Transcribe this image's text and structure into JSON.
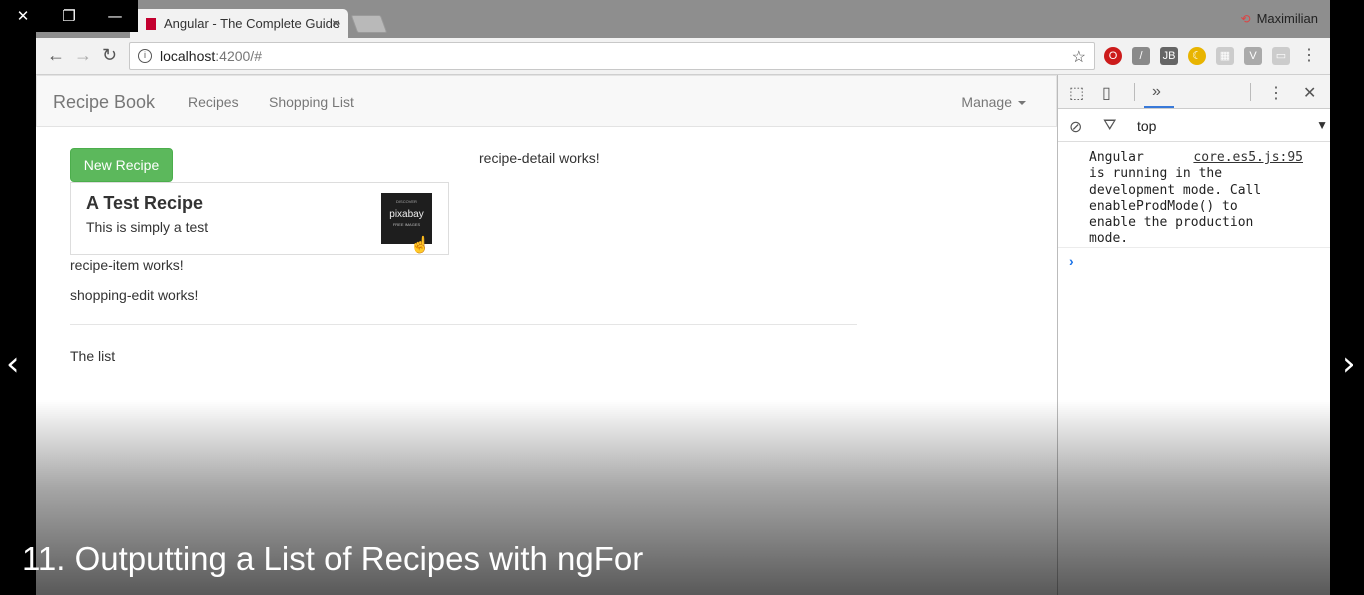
{
  "window": {
    "close": "✕",
    "restore": "❐",
    "minimize": "—"
  },
  "browser": {
    "tab_title": "Angular - The Complete Guide",
    "tab_close": "×",
    "profile_name": "Maximilian",
    "url_host": "localhost",
    "url_path": ":4200/#",
    "back": "←",
    "forward": "→",
    "reload": "↻",
    "star": "☆"
  },
  "app": {
    "brand": "Recipe Book",
    "nav": {
      "recipes": "Recipes",
      "shopping_list": "Shopping List",
      "manage": "Manage"
    },
    "new_recipe_button": "New Recipe",
    "recipe": {
      "name": "A Test Recipe",
      "description": "This is simply a test",
      "image": {
        "line1": "DISCOVER",
        "line2": "pixabay",
        "line3": "FREE IMAGES"
      }
    },
    "recipe_detail_text": "recipe-detail works!",
    "recipe_item_text": "recipe-item works!",
    "shopping_edit_text": "shopping-edit works!",
    "list_text": "The list"
  },
  "devtools": {
    "context": "top",
    "message": "Angular\nis running in the\ndevelopment mode. Call\nenableProdMode() to\nenable the production\nmode.",
    "message_source": "core.es5.js:95",
    "prompt": "›"
  },
  "slides": {
    "prev": "‹",
    "next": "›"
  },
  "caption": "11. Outputting a List of Recipes with ngFor",
  "colors": {
    "success": "#5cb85c",
    "devtools_accent": "#3879d9"
  }
}
